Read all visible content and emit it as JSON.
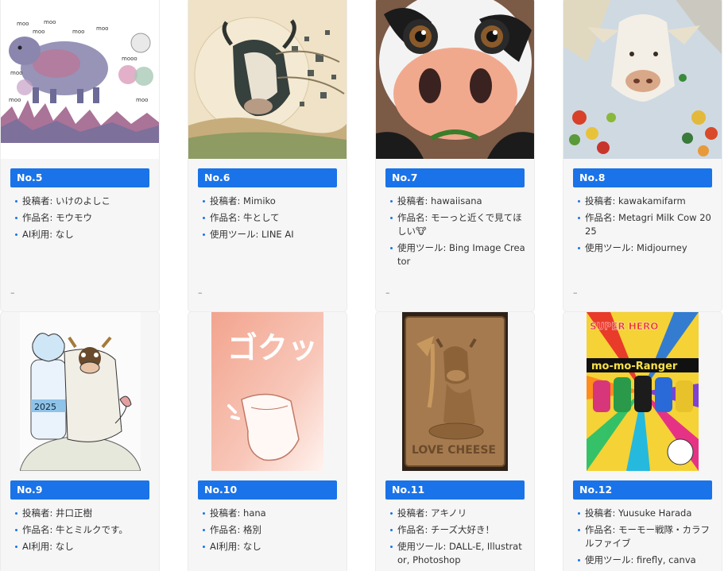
{
  "cards": [
    {
      "no": "No.5",
      "lines": [
        "投稿者: いけのよしこ",
        "作品名: モウモウ",
        "AI利用: なし"
      ],
      "footer": "–",
      "image": {
        "description_icon": "watercolor-cow-icon",
        "moo_text": "moo",
        "moo2_text": "mooo"
      }
    },
    {
      "no": "No.6",
      "lines": [
        "投稿者: Mimiko",
        "作品名: 牛として",
        "使用ツール: LINE AI"
      ],
      "footer": "–",
      "image": {
        "description_icon": "abstract-cow-icon"
      }
    },
    {
      "no": "No.7",
      "lines": [
        "投稿者: hawaiisana",
        "作品名: モーっと近くで見てほしい🐮",
        "使用ツール: Bing Image Creator"
      ],
      "footer": "–",
      "image": {
        "description_icon": "closeup-cow-icon"
      }
    },
    {
      "no": "No.8",
      "lines": [
        "投稿者: kawakamifarm",
        "作品名: Metagri Milk Cow 2025",
        "使用ツール: Midjourney"
      ],
      "footer": "–",
      "image": {
        "description_icon": "painted-cow-icon"
      }
    },
    {
      "no": "No.9",
      "lines": [
        "投稿者: 井口正樹",
        "作品名: 牛とミルクです。",
        "AI利用: なし"
      ],
      "image": {
        "description_icon": "drawn-cow-icon",
        "bottle_text": "2025"
      }
    },
    {
      "no": "No.10",
      "lines": [
        "投稿者: hana",
        "作品名: 格別",
        "AI利用: なし"
      ],
      "image": {
        "description_icon": "gokkun-icon",
        "sound_text": "ゴクッ"
      }
    },
    {
      "no": "No.11",
      "lines": [
        "投稿者: アキノリ",
        "作品名: チーズ大好き！",
        "使用ツール: DALL-E, Illustrator, Photoshop"
      ],
      "image": {
        "description_icon": "cheese-plaque-icon",
        "plaque_text": "LOVE CHEESE"
      }
    },
    {
      "no": "No.12",
      "lines": [
        "投稿者: Yuusuke Harada",
        "作品名: モーモー戦隊・カラフルファイブ",
        "使用ツール: firefly, canva"
      ],
      "image": {
        "description_icon": "hero-poster-icon",
        "logo_text": "SUPER HERO",
        "title_text": "mo-mo-Ranger"
      }
    }
  ]
}
